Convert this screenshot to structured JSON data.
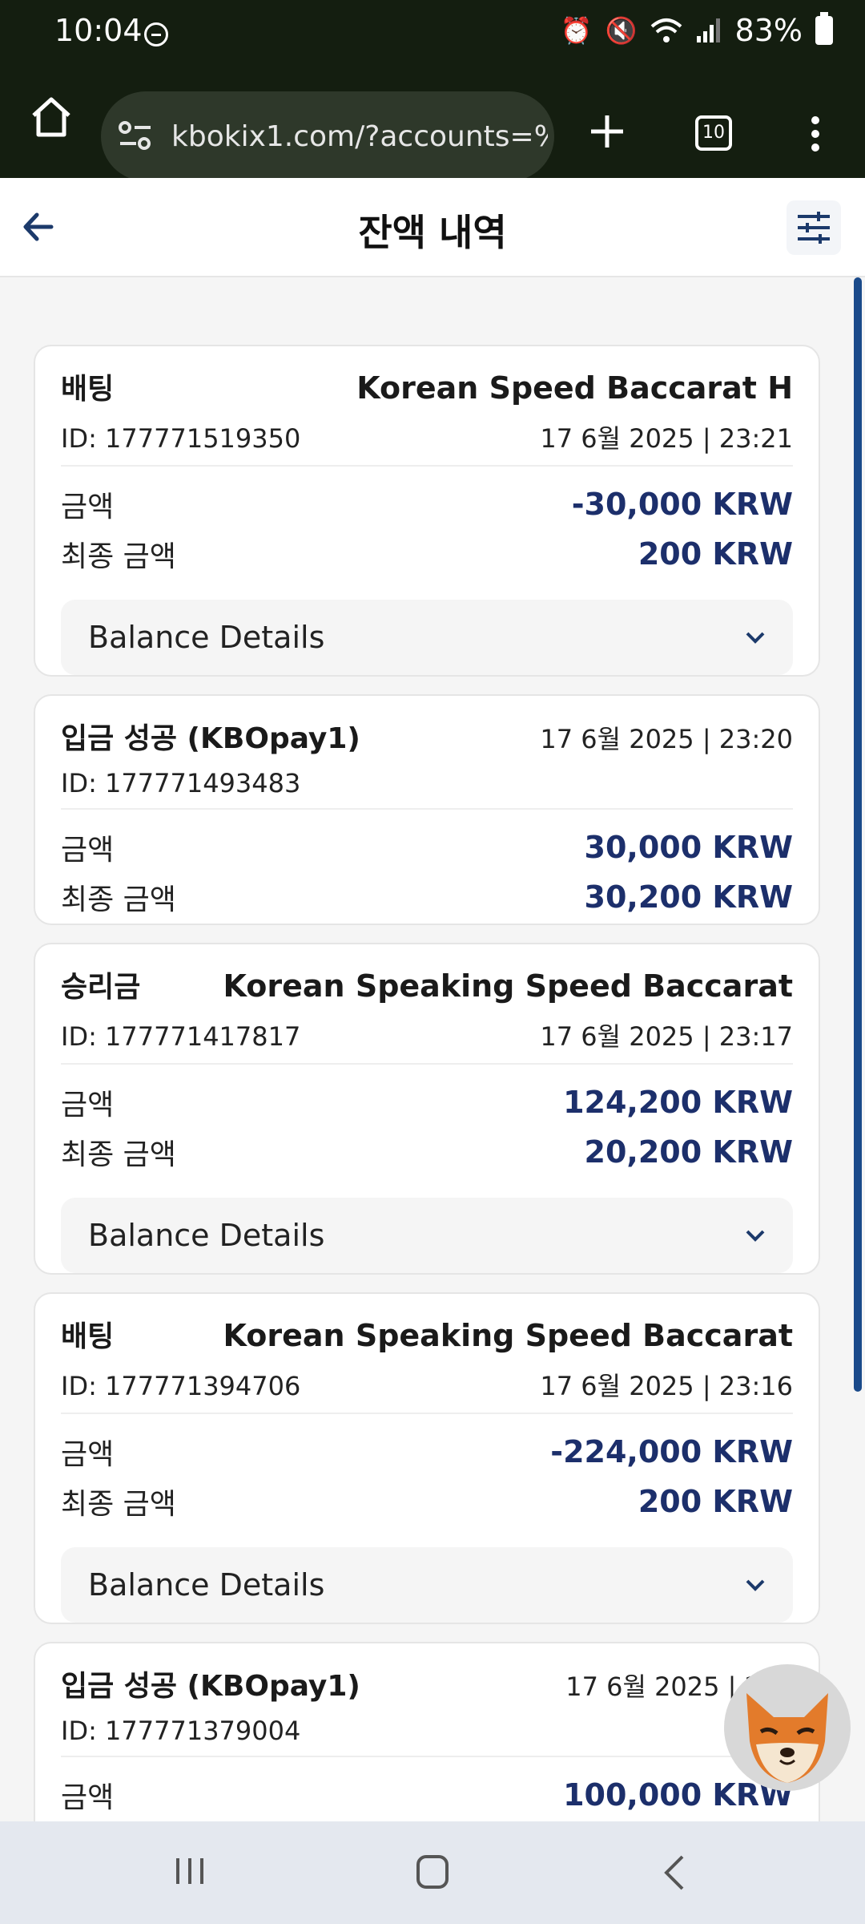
{
  "status": {
    "time": "10:04",
    "battery": "83%"
  },
  "browser": {
    "url": "kbokix1.com/?accounts=%2",
    "tab_count": "10"
  },
  "header": {
    "title": "잔액 내역"
  },
  "labels": {
    "amount": "금액",
    "final_amount": "최종 금액",
    "balance_details": "Balance Details"
  },
  "transactions": [
    {
      "type": "배팅",
      "game": "Korean Speed Baccarat H",
      "id": "ID: 177771519350",
      "datetime": "17 6월 2025 | 23:21",
      "amount": "-30,000 KRW",
      "final_amount": "200 KRW",
      "has_details": true
    },
    {
      "type": "입금 성공 (KBOpay1)",
      "game": "",
      "id": "ID: 177771493483",
      "datetime": "17 6월 2025 | 23:20",
      "amount": "30,000 KRW",
      "final_amount": "30,200 KRW",
      "has_details": false
    },
    {
      "type": "승리금",
      "game": "Korean Speaking Speed Baccarat",
      "id": "ID: 177771417817",
      "datetime": "17 6월 2025 | 23:17",
      "amount": "124,200 KRW",
      "final_amount": "20,200 KRW",
      "has_details": true
    },
    {
      "type": "배팅",
      "game": "Korean Speaking Speed Baccarat",
      "id": "ID: 177771394706",
      "datetime": "17 6월 2025 | 23:16",
      "amount": "-224,000 KRW",
      "final_amount": "200 KRW",
      "has_details": true
    },
    {
      "type": "입금 성공 (KBOpay1)",
      "game": "",
      "id": "ID: 177771379004",
      "datetime": "17 6월 2025 | 2",
      "amount": "100,000 KRW",
      "final_amount": "",
      "has_details": false
    }
  ]
}
